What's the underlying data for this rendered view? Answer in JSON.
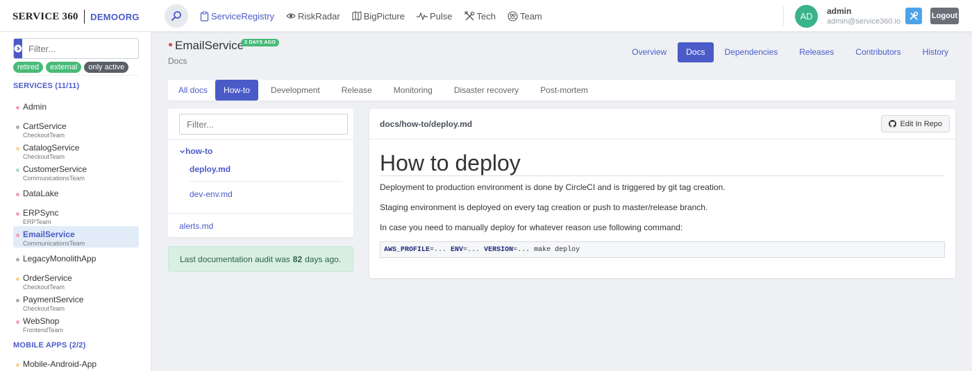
{
  "header": {
    "logo_text": "SERVICE 360",
    "org": "DEMOORG",
    "nav": [
      {
        "label": "ServiceRegistry",
        "icon": "clipboard-icon",
        "active": true
      },
      {
        "label": "RiskRadar",
        "icon": "eye-icon",
        "active": false
      },
      {
        "label": "BigPicture",
        "icon": "map-icon",
        "active": false
      },
      {
        "label": "Pulse",
        "icon": "pulse-icon",
        "active": false
      },
      {
        "label": "Tech",
        "icon": "tools-icon",
        "active": false
      },
      {
        "label": "Team",
        "icon": "team-icon",
        "active": false
      }
    ],
    "user": {
      "initials": "AD",
      "name": "admin",
      "email": "admin@service360.io"
    },
    "logout_label": "Logout"
  },
  "sidebar": {
    "filter_placeholder": "Filter...",
    "tags": [
      "retired",
      "external",
      "only active"
    ],
    "services_title": "SERVICES (11/11)",
    "services": [
      {
        "name": "Admin",
        "team": "",
        "color": "#f3a0b4"
      },
      {
        "name": "CartService",
        "team": "CheckoutTeam",
        "color": "#a8acb2"
      },
      {
        "name": "CatalogService",
        "team": "CheckoutTeam",
        "color": "#f6d58c"
      },
      {
        "name": "CustomerService",
        "team": "CommunicationsTeam",
        "color": "#a9e0c0"
      },
      {
        "name": "DataLake",
        "team": "",
        "color": "#f3a0b4"
      },
      {
        "name": "ERPSync",
        "team": "ERPTeam",
        "color": "#f3a0b4"
      },
      {
        "name": "EmailService",
        "team": "CommunicationsTeam",
        "color": "#f3a0b4"
      },
      {
        "name": "LegacyMonolithApp",
        "team": "",
        "color": "#a8acb2"
      },
      {
        "name": "OrderService",
        "team": "CheckoutTeam",
        "color": "#f6d58c"
      },
      {
        "name": "PaymentService",
        "team": "CheckoutTeam",
        "color": "#a8acb2"
      },
      {
        "name": "WebShop",
        "team": "FrontendTeam",
        "color": "#f3a0b4"
      }
    ],
    "mobile_title": "MOBILE APPS (2/2)",
    "mobile_apps": [
      {
        "name": "Mobile-Android-App",
        "team": "",
        "color": "#f6d58c"
      }
    ]
  },
  "main": {
    "service_name": "EmailService",
    "age_badge": "3 DAYS AGO",
    "subtitle": "Docs",
    "tabs": [
      "Overview",
      "Docs",
      "Dependencies",
      "Releases",
      "Contributors",
      "History"
    ],
    "active_tab": "Docs",
    "doc_tabs": [
      "All docs",
      "How-to",
      "Development",
      "Release",
      "Monitoring",
      "Disaster recovery",
      "Post-mortem"
    ],
    "active_doc_tab": "How-to",
    "tree": {
      "filter_placeholder": "Filter...",
      "folder": "how-to",
      "files": [
        "deploy.md",
        "dev-env.md"
      ],
      "root_files": [
        "alerts.md"
      ]
    },
    "audit": {
      "prefix": "Last documentation audit was",
      "days": "82",
      "suffix": "days ago."
    },
    "doc": {
      "path": "docs/how-to/deploy.md",
      "edit_label": "Edit In Repo",
      "title": "How to deploy",
      "paragraphs": [
        "Deployment to production environment is done by CircleCI and is triggered by git tag creation.",
        "Staging environment is deployed on every tag creation or push to master/release branch.",
        "In case you need to manually deploy for whatever reason use following command:"
      ],
      "code": {
        "var1": "AWS_PROFILE",
        "val1": "=... ",
        "var2": "ENV",
        "val2": "=... ",
        "var3": "VERSION",
        "val3": "=... make deploy"
      }
    }
  },
  "colors": {
    "accent": "#4a5bc8",
    "green": "#48bb78",
    "avatar": "#3ab38a",
    "selected_bg": "#e2ecf8"
  }
}
